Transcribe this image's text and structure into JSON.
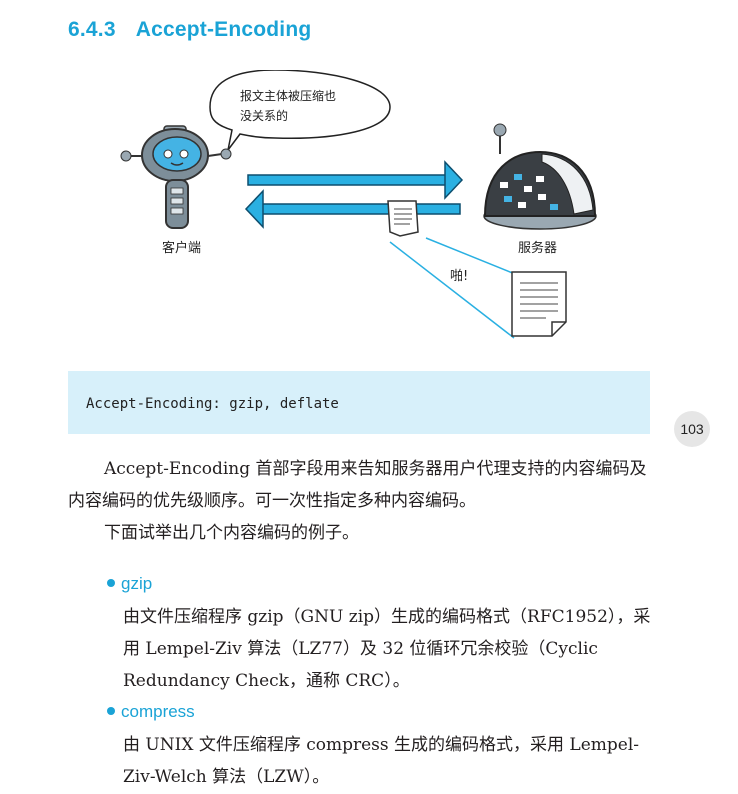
{
  "section": {
    "number": "6.4.3",
    "title": "Accept-Encoding"
  },
  "figure": {
    "bubble_line1": "报文主体被压缩也",
    "bubble_line2": "没关系的",
    "client_label": "客户端",
    "server_label": "服务器",
    "sound_label": "啪!"
  },
  "code": "Accept-Encoding: gzip, deflate",
  "page_number": "103",
  "paragraphs": [
    "Accept-Encoding 首部字段用来告知服务器用户代理支持的内容编码及内容编码的优先级顺序。可一次性指定多种内容编码。",
    "下面试举出几个内容编码的例子。"
  ],
  "bullets": [
    {
      "title": "gzip",
      "body": "由文件压缩程序 gzip（GNU zip）生成的编码格式（RFC1952），采用 Lempel-Ziv 算法（LZ77）及 32 位循环冗余校验（Cyclic Redundancy Check，通称 CRC）。"
    },
    {
      "title": "compress",
      "body": "由 UNIX 文件压缩程序 compress 生成的编码格式，采用 Lempel-Ziv-Welch 算法（LZW）。"
    }
  ],
  "colors": {
    "accent": "#1aa3d6",
    "code_bg": "#d7f0fa"
  }
}
